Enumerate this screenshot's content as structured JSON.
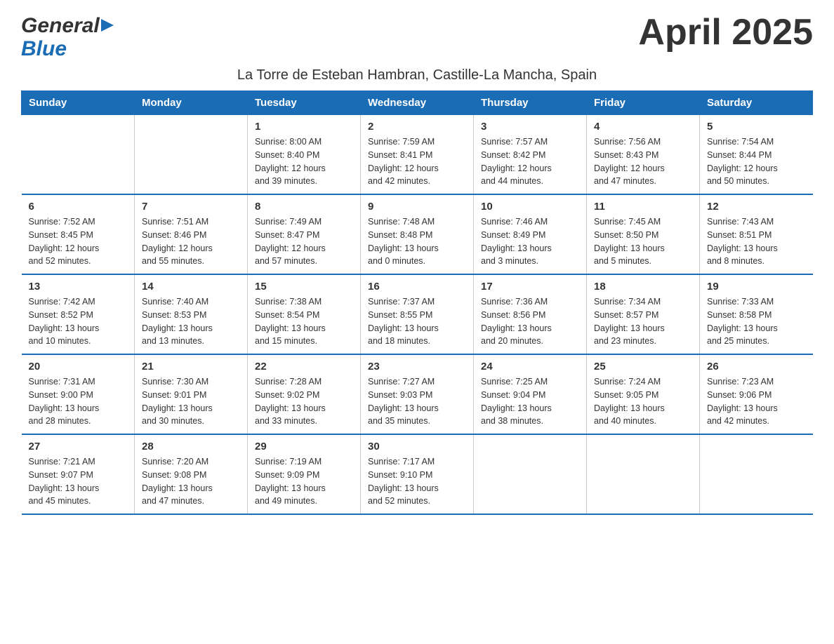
{
  "header": {
    "logo_line1": "General",
    "logo_line2": "Blue",
    "month_title": "April 2025",
    "subtitle": "La Torre de Esteban Hambran, Castille-La Mancha, Spain"
  },
  "weekdays": [
    "Sunday",
    "Monday",
    "Tuesday",
    "Wednesday",
    "Thursday",
    "Friday",
    "Saturday"
  ],
  "weeks": [
    [
      {
        "day": "",
        "info": ""
      },
      {
        "day": "",
        "info": ""
      },
      {
        "day": "1",
        "info": "Sunrise: 8:00 AM\nSunset: 8:40 PM\nDaylight: 12 hours\nand 39 minutes."
      },
      {
        "day": "2",
        "info": "Sunrise: 7:59 AM\nSunset: 8:41 PM\nDaylight: 12 hours\nand 42 minutes."
      },
      {
        "day": "3",
        "info": "Sunrise: 7:57 AM\nSunset: 8:42 PM\nDaylight: 12 hours\nand 44 minutes."
      },
      {
        "day": "4",
        "info": "Sunrise: 7:56 AM\nSunset: 8:43 PM\nDaylight: 12 hours\nand 47 minutes."
      },
      {
        "day": "5",
        "info": "Sunrise: 7:54 AM\nSunset: 8:44 PM\nDaylight: 12 hours\nand 50 minutes."
      }
    ],
    [
      {
        "day": "6",
        "info": "Sunrise: 7:52 AM\nSunset: 8:45 PM\nDaylight: 12 hours\nand 52 minutes."
      },
      {
        "day": "7",
        "info": "Sunrise: 7:51 AM\nSunset: 8:46 PM\nDaylight: 12 hours\nand 55 minutes."
      },
      {
        "day": "8",
        "info": "Sunrise: 7:49 AM\nSunset: 8:47 PM\nDaylight: 12 hours\nand 57 minutes."
      },
      {
        "day": "9",
        "info": "Sunrise: 7:48 AM\nSunset: 8:48 PM\nDaylight: 13 hours\nand 0 minutes."
      },
      {
        "day": "10",
        "info": "Sunrise: 7:46 AM\nSunset: 8:49 PM\nDaylight: 13 hours\nand 3 minutes."
      },
      {
        "day": "11",
        "info": "Sunrise: 7:45 AM\nSunset: 8:50 PM\nDaylight: 13 hours\nand 5 minutes."
      },
      {
        "day": "12",
        "info": "Sunrise: 7:43 AM\nSunset: 8:51 PM\nDaylight: 13 hours\nand 8 minutes."
      }
    ],
    [
      {
        "day": "13",
        "info": "Sunrise: 7:42 AM\nSunset: 8:52 PM\nDaylight: 13 hours\nand 10 minutes."
      },
      {
        "day": "14",
        "info": "Sunrise: 7:40 AM\nSunset: 8:53 PM\nDaylight: 13 hours\nand 13 minutes."
      },
      {
        "day": "15",
        "info": "Sunrise: 7:38 AM\nSunset: 8:54 PM\nDaylight: 13 hours\nand 15 minutes."
      },
      {
        "day": "16",
        "info": "Sunrise: 7:37 AM\nSunset: 8:55 PM\nDaylight: 13 hours\nand 18 minutes."
      },
      {
        "day": "17",
        "info": "Sunrise: 7:36 AM\nSunset: 8:56 PM\nDaylight: 13 hours\nand 20 minutes."
      },
      {
        "day": "18",
        "info": "Sunrise: 7:34 AM\nSunset: 8:57 PM\nDaylight: 13 hours\nand 23 minutes."
      },
      {
        "day": "19",
        "info": "Sunrise: 7:33 AM\nSunset: 8:58 PM\nDaylight: 13 hours\nand 25 minutes."
      }
    ],
    [
      {
        "day": "20",
        "info": "Sunrise: 7:31 AM\nSunset: 9:00 PM\nDaylight: 13 hours\nand 28 minutes."
      },
      {
        "day": "21",
        "info": "Sunrise: 7:30 AM\nSunset: 9:01 PM\nDaylight: 13 hours\nand 30 minutes."
      },
      {
        "day": "22",
        "info": "Sunrise: 7:28 AM\nSunset: 9:02 PM\nDaylight: 13 hours\nand 33 minutes."
      },
      {
        "day": "23",
        "info": "Sunrise: 7:27 AM\nSunset: 9:03 PM\nDaylight: 13 hours\nand 35 minutes."
      },
      {
        "day": "24",
        "info": "Sunrise: 7:25 AM\nSunset: 9:04 PM\nDaylight: 13 hours\nand 38 minutes."
      },
      {
        "day": "25",
        "info": "Sunrise: 7:24 AM\nSunset: 9:05 PM\nDaylight: 13 hours\nand 40 minutes."
      },
      {
        "day": "26",
        "info": "Sunrise: 7:23 AM\nSunset: 9:06 PM\nDaylight: 13 hours\nand 42 minutes."
      }
    ],
    [
      {
        "day": "27",
        "info": "Sunrise: 7:21 AM\nSunset: 9:07 PM\nDaylight: 13 hours\nand 45 minutes."
      },
      {
        "day": "28",
        "info": "Sunrise: 7:20 AM\nSunset: 9:08 PM\nDaylight: 13 hours\nand 47 minutes."
      },
      {
        "day": "29",
        "info": "Sunrise: 7:19 AM\nSunset: 9:09 PM\nDaylight: 13 hours\nand 49 minutes."
      },
      {
        "day": "30",
        "info": "Sunrise: 7:17 AM\nSunset: 9:10 PM\nDaylight: 13 hours\nand 52 minutes."
      },
      {
        "day": "",
        "info": ""
      },
      {
        "day": "",
        "info": ""
      },
      {
        "day": "",
        "info": ""
      }
    ]
  ]
}
